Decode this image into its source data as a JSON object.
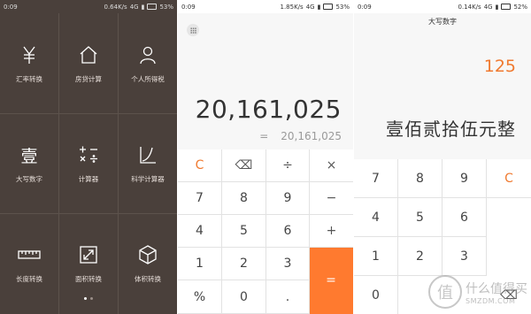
{
  "panel1": {
    "status": {
      "time": "0:09",
      "speed": "0.64K/s",
      "network": "4G",
      "battery": "53%"
    },
    "tools": [
      {
        "label": "汇率转换",
        "icon": "currency-yen-icon"
      },
      {
        "label": "房贷计算",
        "icon": "house-icon"
      },
      {
        "label": "个人所得税",
        "icon": "person-icon"
      },
      {
        "label": "大写数字",
        "icon": "chinese-numeral-icon",
        "glyph": "壹"
      },
      {
        "label": "计算器",
        "icon": "calculator-icon"
      },
      {
        "label": "科学计算器",
        "icon": "scientific-graph-icon"
      },
      {
        "label": "长度转换",
        "icon": "ruler-icon"
      },
      {
        "label": "面积转换",
        "icon": "area-arrows-icon"
      },
      {
        "label": "体积转换",
        "icon": "cube-icon"
      }
    ],
    "page_dots": 2,
    "active_page": 1
  },
  "panel2": {
    "status": {
      "time": "0:09",
      "speed": "1.85K/s",
      "network": "4G",
      "battery": "53%"
    },
    "expression": "20,161,025",
    "result_sign": "=",
    "result": "20,161,025",
    "keys": [
      [
        "C",
        "⌫",
        "÷",
        "×"
      ],
      [
        "7",
        "8",
        "9",
        "−"
      ],
      [
        "4",
        "5",
        "6",
        "+"
      ],
      [
        "1",
        "2",
        "3",
        "="
      ],
      [
        "%",
        "0",
        "."
      ]
    ]
  },
  "panel3": {
    "status": {
      "time": "0:09",
      "speed": "0.14K/s",
      "network": "4G",
      "battery": "52%"
    },
    "title": "大写数字",
    "number": "125",
    "chinese": "壹佰贰拾伍元整",
    "keys": [
      [
        "7",
        "8",
        "9",
        "C"
      ],
      [
        "4",
        "5",
        "6"
      ],
      [
        "1",
        "2",
        "3"
      ],
      [
        "0",
        "⌫"
      ]
    ],
    "watermark": {
      "glyph": "值",
      "text": "什么值得买",
      "sub": "SMZDM.COM"
    }
  },
  "colors": {
    "accent": "#ff7a2f",
    "tools_bg": "#4a403b"
  }
}
